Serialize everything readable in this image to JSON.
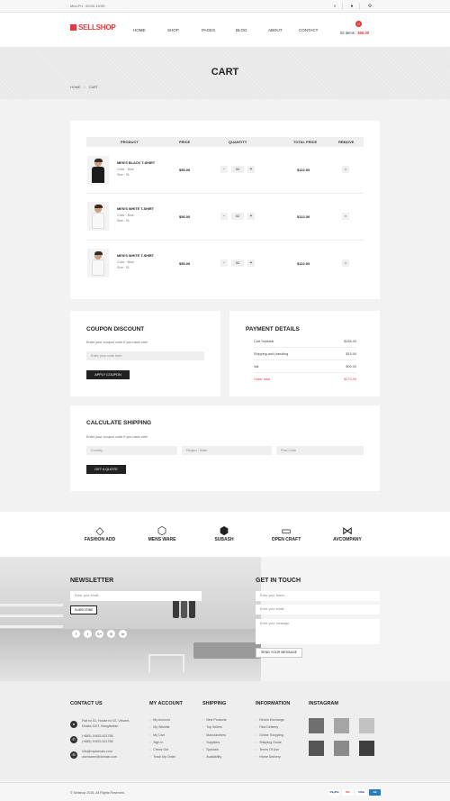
{
  "topbar": {
    "hours": "Mon-Fri : 09:00-19:00"
  },
  "header": {
    "logo": "SELLSHOP",
    "nav": [
      "HOME",
      "SHOP",
      "PAGES",
      "BLOG",
      "ABOUT",
      "CONTACT"
    ],
    "cart_count": "0",
    "cart_items": "02 items :",
    "cart_total": "$56.00"
  },
  "page": {
    "title": "CART",
    "breadcrumb_home": "HOME",
    "breadcrumb_sep": "/",
    "breadcrumb_current": "CART"
  },
  "cart": {
    "columns": [
      "PRODUCT",
      "PRICE",
      "QUANTITY",
      "TOTAL PRICE",
      "REMOVE"
    ],
    "items": [
      {
        "name": "MEN'S BLACK T-SHIRT",
        "color": "Color : Blue",
        "size": "Size : SL",
        "price": "$56.00",
        "qty": "02",
        "total": "$112.00",
        "minus": "-",
        "plus": "+",
        "remove": "×",
        "shirt": "#1c1c1c"
      },
      {
        "name": "MEN'S WHITE T-SHIRT",
        "color": "Color : Blue",
        "size": "Size : SL",
        "price": "$56.00",
        "qty": "02",
        "total": "$112.00",
        "minus": "-",
        "plus": "+",
        "remove": "×",
        "shirt": "#f5f5f5"
      },
      {
        "name": "MEN'S WHITE T-SHIRT",
        "color": "Color : Blue",
        "size": "Size : SL",
        "price": "$56.00",
        "qty": "02",
        "total": "$112.00",
        "minus": "-",
        "plus": "+",
        "remove": "×",
        "shirt": "#f5f5f5"
      }
    ]
  },
  "coupon": {
    "title": "COUPON DISCOUNT",
    "subtitle": "Enter your coupon code if you have one!",
    "placeholder": "Enter your code here.",
    "button": "APPLY COUPON"
  },
  "payment": {
    "title": "PAYMENT DETAILS",
    "rows": [
      {
        "label": "Cart Subtotal",
        "value": "$155.00"
      },
      {
        "label": "Shipping and Handling",
        "value": "$15.00"
      },
      {
        "label": "Vat",
        "value": "$00.00"
      },
      {
        "label": "Order total",
        "value": "$170.00"
      }
    ]
  },
  "shipping": {
    "title": "CALCULATE SHIPPING",
    "subtitle": "Enter your coupon code if you have one!",
    "country": "Country",
    "region": "Region / State",
    "post": "Post Code",
    "button": "GET A QUOTE"
  },
  "brands": [
    {
      "name": "FASHION ADD",
      "icon": "◇"
    },
    {
      "name": "MENS WARE",
      "icon": "⬡"
    },
    {
      "name": "SUBASH",
      "icon": "⬢"
    },
    {
      "name": "OPEN CRAFT",
      "icon": "▭"
    },
    {
      "name": "AVCOMPANY",
      "icon": "⋈"
    }
  ],
  "newsletter": {
    "title": "NEWSLETTER",
    "placeholder": "Enter your email...",
    "button": "SUBSCRIBE",
    "social": [
      "f",
      "t",
      "G+",
      "◎",
      "in"
    ]
  },
  "touch": {
    "title": "GET IN TOUCH",
    "name": "Enter your Name...",
    "email": "Enter your email...",
    "message": "Enter your message...",
    "button": "SEND YOUR MESSAGE"
  },
  "footer": {
    "contact_title": "CONTACT US",
    "address": [
      "Flat no 01, House no 02, Vincent,",
      "Dhaka 1207, Bangladesh"
    ],
    "phones": [
      "(+880) 19453 821758",
      "(+880) 19453 821758"
    ],
    "emails": [
      "info@mydomain.com",
      "username@domain.com"
    ],
    "account_title": "MY ACCOUNT",
    "account": [
      "My Account",
      "My Wishlist",
      "My Cart",
      "Sign In",
      "Check Out",
      "Track My Order"
    ],
    "shipping_title": "SHIPPING",
    "shipping_links": [
      "New Products",
      "Top Sellers",
      "Manufactirers",
      "Suppliers",
      "Specials",
      "Availability"
    ],
    "info_title": "INFORMATION",
    "info": [
      "Return Exchange",
      "Fast Delivery",
      "Online Shopping",
      "Shipping Guide",
      "Terms Of Use",
      "Home Delivery"
    ],
    "instagram_title": "INSTAGRAM",
    "copyright": "© Sellshop 2016. All Rights Reserved.",
    "payments": [
      "PayPal",
      "MC",
      "VISA",
      "AE"
    ]
  }
}
